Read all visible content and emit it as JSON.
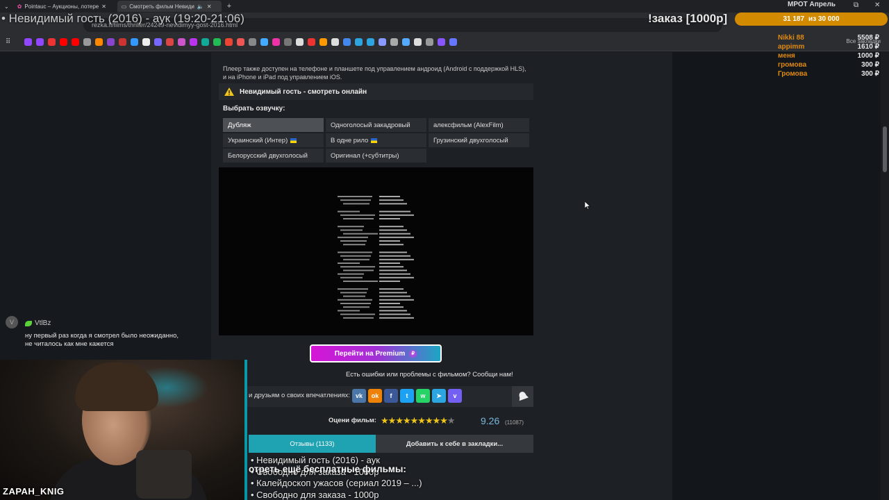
{
  "browser": {
    "tabs": [
      {
        "label": "Pointauc – Аукционы, лотере",
        "active": false
      },
      {
        "label": "Смотреть фильм Невиди",
        "active": true
      }
    ],
    "url": "rezka.fi/films/thriller/24249-nevidimyy-gost-2016.html",
    "bookmarks_all": "Все закладки"
  },
  "stream": {
    "title": "• Невидимый гость (2016) - аук (19:20-21:06)",
    "order_label": "!заказ [1000р]",
    "goal_text": "31 187",
    "goal_target": "из 30 000",
    "goal_fill": 1.0,
    "mrot_label": "МРОТ Апрель",
    "donors": [
      {
        "name": "Nikki 88",
        "amount": "5508 ₽"
      },
      {
        "name": "appimm",
        "amount": "1610 ₽"
      },
      {
        "name": "меня",
        "amount": "1000 ₽"
      },
      {
        "name": "громова",
        "amount": "300 ₽"
      },
      {
        "name": "Громова",
        "amount": "300 ₽"
      }
    ],
    "queue": [
      "• Невидимый гость (2016) - аук",
      "• Свободно для заказа - 1000р",
      "• Калейдоскоп ужасов (сериал 2019 – ...)",
      "• Свободно для заказа - 1000р"
    ],
    "queue_header": "отреть ещё бесплатные фильмы:",
    "streamer": "ZAPAH_KNIG"
  },
  "chat": {
    "avatar_letter": "V",
    "user": "VtlBz",
    "text": "ну первый раз когда я смотрел было неожиданно, не читалось как мне кажется"
  },
  "page": {
    "note": "Плеер также доступен на телефоне и планшете под управлением андроид (Android с поддержкой HLS), и на iPhone и iPad под управлением iOS.",
    "title": "Невидимый гость - смотреть онлайн",
    "voice_label": "Выбрать озвучку:",
    "voices": [
      {
        "label": "Дубляж",
        "active": true,
        "flag": false
      },
      {
        "label": "Одноголосый закадровый",
        "active": false,
        "flag": false
      },
      {
        "label": "алексфильм (AlexFilm)",
        "active": false,
        "flag": false
      },
      {
        "label": "Украинский (Интер)",
        "active": false,
        "flag": true
      },
      {
        "label": "В одне рило",
        "active": false,
        "flag": true
      },
      {
        "label": "Грузинский двухголосый",
        "active": false,
        "flag": false
      },
      {
        "label": "Белорусский двухголосый",
        "active": false,
        "flag": false
      },
      {
        "label": "Оригинал (+субтитры)",
        "active": false,
        "flag": false
      }
    ],
    "premium_button": "Перейти на Premium",
    "report": "Есть ошибки или проблемы с фильмом? Сообщи нам!",
    "share_label": "и друзьям о своих впечатлениях:",
    "share_icons": [
      {
        "name": "vk",
        "glyph": "vk",
        "color": "#4a76a8"
      },
      {
        "name": "odnoklassniki",
        "glyph": "ok",
        "color": "#ee8208"
      },
      {
        "name": "facebook",
        "glyph": "f",
        "color": "#3b5998"
      },
      {
        "name": "twitter",
        "glyph": "t",
        "color": "#1da1f2"
      },
      {
        "name": "whatsapp",
        "glyph": "w",
        "color": "#25d366"
      },
      {
        "name": "telegram",
        "glyph": "➤",
        "color": "#2ca5e0"
      },
      {
        "name": "viber",
        "glyph": "v",
        "color": "#7360f2"
      }
    ],
    "rating_label": "Оцени фильм:",
    "rating_value": "9.26",
    "rating_count": "(11087)",
    "stars_filled": 9,
    "stars_total": 10,
    "tab_reviews": "Отзывы (1133)",
    "tab_bookmark": "Добавить к себе в закладки..."
  },
  "colors": {
    "accent": "#1fa3b3",
    "goal": "#d28b00",
    "donor": "#e08a10"
  }
}
